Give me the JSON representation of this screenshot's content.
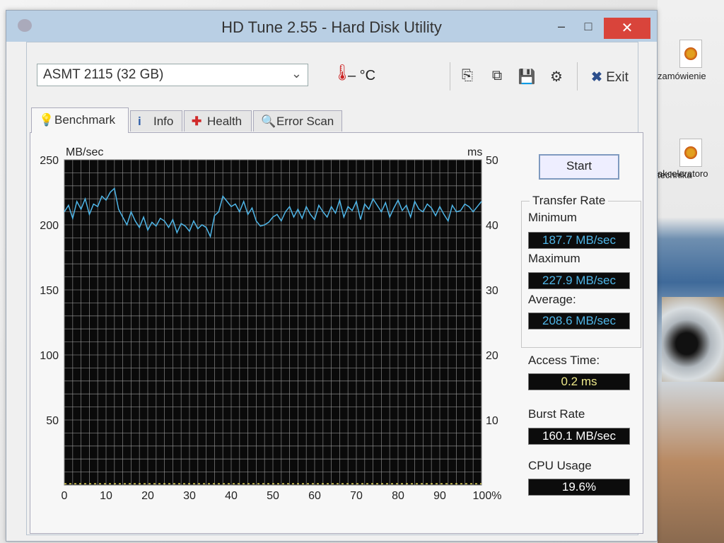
{
  "desktop": {
    "icons": [
      {
        "label": "zamówienie"
      },
      {
        "label": "technika"
      },
      {
        "label": "akceleratoro"
      }
    ]
  },
  "window": {
    "title": "HD Tune 2.55 - Hard Disk Utility",
    "controls": {
      "minimize": "–",
      "maximize": "□",
      "close": "✕"
    }
  },
  "toolbar": {
    "drive": "ASMT    2115 (32 GB)",
    "temperature": "– °C",
    "exit_label": "Exit"
  },
  "tabs": [
    {
      "label": "Benchmark",
      "active": true
    },
    {
      "label": "Info"
    },
    {
      "label": "Health"
    },
    {
      "label": "Error Scan"
    }
  ],
  "controls": {
    "start_label": "Start"
  },
  "stats": {
    "transfer_rate_title": "Transfer Rate",
    "minimum_label": "Minimum",
    "minimum_value": "187.7 MB/sec",
    "maximum_label": "Maximum",
    "maximum_value": "227.9 MB/sec",
    "average_label": "Average:",
    "average_value": "208.6 MB/sec",
    "access_time_label": "Access Time:",
    "access_time_value": "0.2 ms",
    "burst_rate_label": "Burst Rate",
    "burst_rate_value": "160.1 MB/sec",
    "cpu_usage_label": "CPU Usage",
    "cpu_usage_value": "19.6%"
  },
  "colors": {
    "plot_bg": "#0a0a0a",
    "grid": "#9a9a9a",
    "transfer_line": "#4fb6e8",
    "access_line": "#e6d85a"
  },
  "chart_data": {
    "type": "line",
    "xlabel": "",
    "ylabel": "MB/sec",
    "y2label": "ms",
    "xlim": [
      0,
      100
    ],
    "ylim": [
      0,
      250
    ],
    "y2lim": [
      0,
      50
    ],
    "x_ticks": [
      "0",
      "10",
      "20",
      "30",
      "40",
      "50",
      "60",
      "70",
      "80",
      "90",
      "100%"
    ],
    "y_ticks": [
      "250",
      "200",
      "150",
      "100",
      "50"
    ],
    "y2_ticks": [
      "50",
      "40",
      "30",
      "20",
      "10"
    ],
    "series": [
      {
        "values_x": [
          0,
          1,
          2,
          3,
          4,
          5,
          6,
          7,
          8,
          9,
          10,
          11,
          12,
          13,
          14,
          15,
          16,
          17,
          18,
          19,
          20,
          21,
          22,
          23,
          24,
          25,
          26,
          27,
          28,
          29,
          30,
          31,
          32,
          33,
          34,
          35,
          36,
          37,
          38,
          39,
          40,
          41,
          42,
          43,
          44,
          45,
          46,
          47,
          48,
          49,
          50,
          51,
          52,
          53,
          54,
          55,
          56,
          57,
          58,
          59,
          60,
          61,
          62,
          63,
          64,
          65,
          66,
          67,
          68,
          69,
          70,
          71,
          72,
          73,
          74,
          75,
          76,
          77,
          78,
          79,
          80,
          81,
          82,
          83,
          84,
          85,
          86,
          87,
          88,
          89,
          90,
          91,
          92,
          93,
          94,
          95,
          96,
          97,
          98,
          99,
          100
        ],
        "values_y": [
          210,
          215,
          205,
          218,
          212,
          220,
          208,
          216,
          214,
          222,
          219,
          225,
          228,
          212,
          206,
          200,
          210,
          203,
          198,
          206,
          196,
          202,
          199,
          205,
          203,
          198,
          204,
          194,
          201,
          199,
          195,
          203,
          197,
          200,
          198,
          191,
          207,
          210,
          222,
          218,
          214,
          216,
          210,
          218,
          208,
          213,
          203,
          199,
          200,
          202,
          206,
          208,
          203,
          210,
          214,
          206,
          212,
          205,
          214,
          208,
          204,
          215,
          210,
          206,
          214,
          209,
          219,
          206,
          214,
          211,
          218,
          204,
          216,
          212,
          220,
          215,
          210,
          217,
          206,
          213,
          219,
          211,
          215,
          206,
          218,
          212,
          210,
          216,
          213,
          207,
          214,
          208,
          203,
          215,
          210,
          211,
          216,
          214,
          210,
          214,
          218
        ]
      },
      {
        "values_x": [
          0,
          100
        ],
        "values_y": [
          0.2,
          0.2
        ]
      }
    ]
  }
}
